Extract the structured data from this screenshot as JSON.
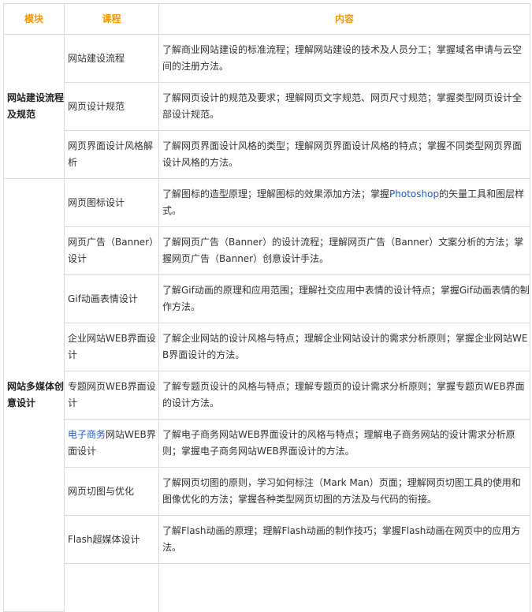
{
  "headers": {
    "module": "模块",
    "course": "课程",
    "content": "内容"
  },
  "modules": [
    {
      "name": "网站建设流程及规范",
      "rowspan": 3
    },
    {
      "name": "网站多媒体创意设计",
      "rowspan": 9
    }
  ],
  "rows": [
    {
      "course": "网站建设流程",
      "content": "了解商业网站建设的标准流程；理解网站建设的技术及人员分工；掌握域名申请与云空间的注册方法。"
    },
    {
      "course": "网页设计规范",
      "content": "了解网页设计的规范及要求；理解网页文字规范、网页尺寸规范；掌握类型网页设计全部设计规范。"
    },
    {
      "course": "网页界面设计风格解析",
      "content": "了解网页界面设计风格的类型；理解网页界面设计风格的特点；掌握不同类型网页界面设计风格的方法。"
    },
    {
      "course": "网页图标设计",
      "content_before": "了解图标的造型原理；理解图标的效果添加方法；掌握",
      "content_link": "Photoshop",
      "content_after": "的矢量工具和图层样式。"
    },
    {
      "course": "网页广告（Banner）设计",
      "content": "了解网页广告（Banner）的设计流程；理解网页广告（Banner）文案分析的方法；掌握网页广告（Banner）创意设计手法。"
    },
    {
      "course": "Gif动画表情设计",
      "content": "了解Gif动画的原理和应用范围；理解社交应用中表情的设计特点；掌握Gif动画表情的制作方法。"
    },
    {
      "course": "企业网站WEB界面设计",
      "content": "了解企业网站的设计风格与特点；理解企业网站设计的需求分析原则；掌握企业网站WEB界面设计的方法。"
    },
    {
      "course": "专题网页WEB界面设计",
      "content": "了解专题页设计的风格与特点；理解专题页的设计需求分析原则；掌握专题页WEB界面的设计方法。"
    },
    {
      "course_link": "电子商务",
      "course_rest": "网站WEB界面设计",
      "content": "了解电子商务网站WEB界面设计的风格与特点；理解电子商务网站的设计需求分析原则；掌握电子商务网站WEB界面设计的方法。"
    },
    {
      "course": "网页切图与优化",
      "content": "了解网页切图的原则，学习如何标注（Mark Man）页面；理解网页切图工具的使用和图像优化的方法；掌握各种类型网页切图的方法及与代码的衔接。"
    },
    {
      "course": "Flash超媒体设计",
      "content": "了解Flash动画的原理；理解Flash动画的制作技巧；掌握Flash动画在网页中的应用方法。"
    }
  ]
}
